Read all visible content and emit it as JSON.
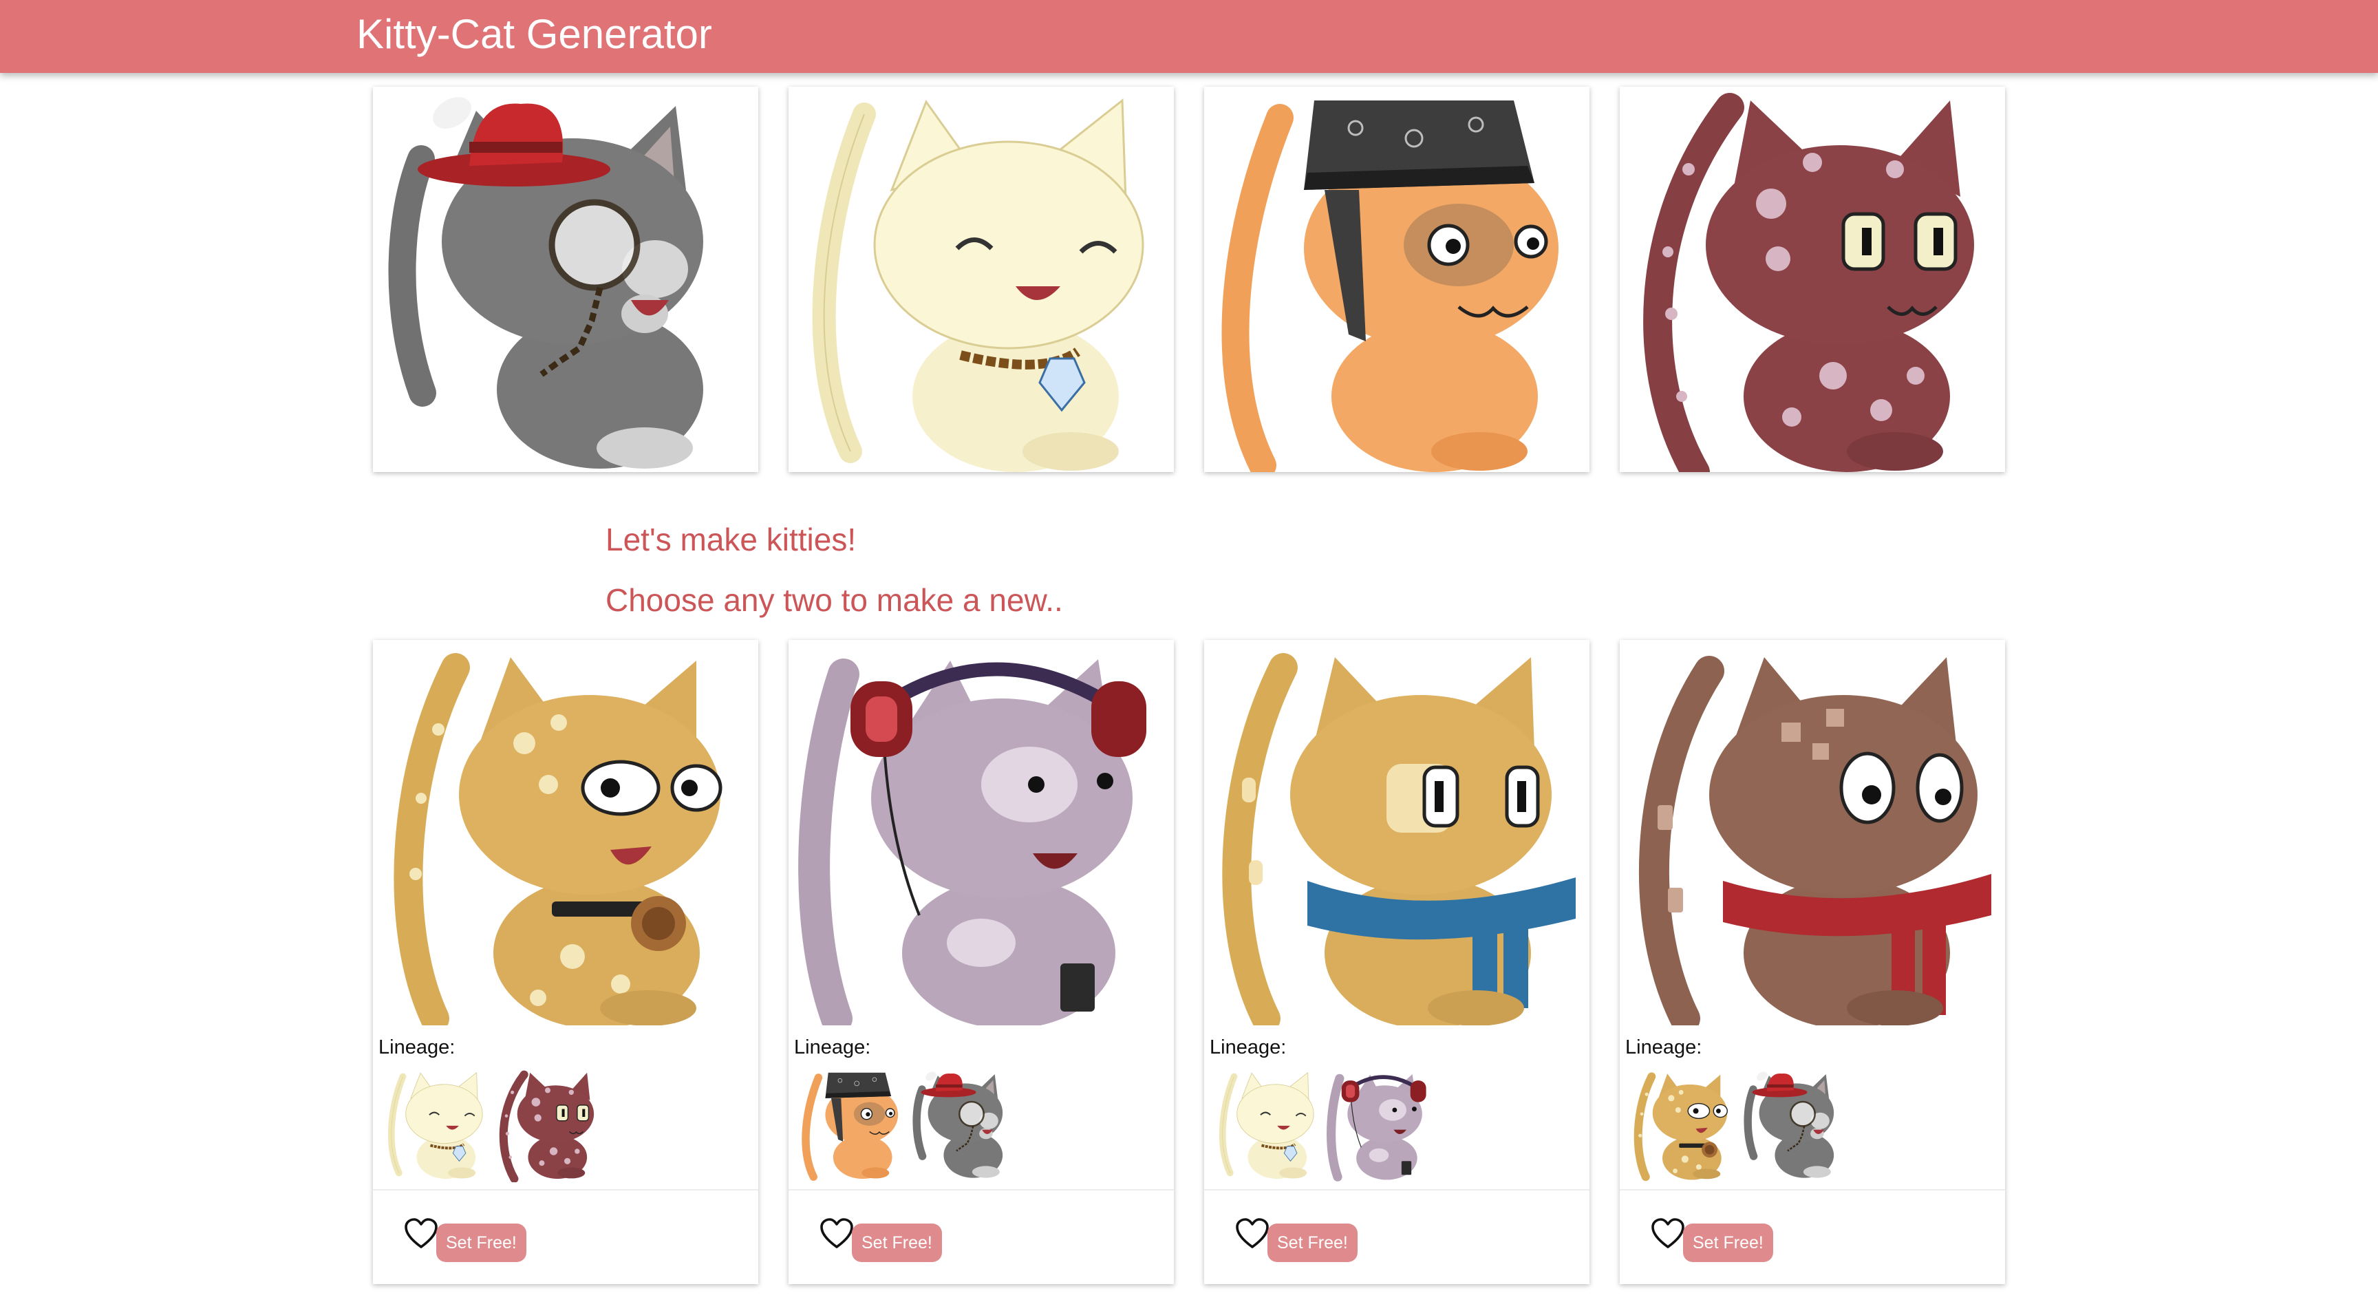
{
  "app": {
    "title": "Kitty-Cat Generator"
  },
  "colors": {
    "navbar": "#e07375",
    "accent_text": "#cc5558",
    "button": "#df8a8d"
  },
  "intro": {
    "line1": "Let's make kitties!",
    "line2": "Choose any two to make a new.."
  },
  "parents": [
    {
      "name": "gray-cat-with-top-hat-and-monocle"
    },
    {
      "name": "cream-cat-with-diamond-collar"
    },
    {
      "name": "orange-cat-with-paisley-bandana"
    },
    {
      "name": "maroon-spotted-cat"
    }
  ],
  "offspring": [
    {
      "name": "golden-spotted-cat-with-sock-monkey-collar",
      "lineage_label": "Lineage:",
      "lineage": [
        "cream-cat-with-diamond-collar",
        "maroon-spotted-cat"
      ],
      "free_label": "Set Free!",
      "like_icon": "heart-outline-icon"
    },
    {
      "name": "lavender-cat-with-headphones",
      "lineage_label": "Lineage:",
      "lineage": [
        "orange-cat-with-paisley-bandana",
        "gray-cat-with-top-hat-and-monocle"
      ],
      "free_label": "Set Free!",
      "like_icon": "heart-outline-icon"
    },
    {
      "name": "golden-cat-with-blue-scarf",
      "lineage_label": "Lineage:",
      "lineage": [
        "cream-cat-with-diamond-collar",
        "lavender-cat-with-headphones"
      ],
      "free_label": "Set Free!",
      "like_icon": "heart-outline-icon"
    },
    {
      "name": "brown-cat-with-red-scarf",
      "lineage_label": "Lineage:",
      "lineage": [
        "golden-spotted-cat-with-sock-monkey-collar",
        "gray-cat-with-top-hat-and-monocle"
      ],
      "free_label": "Set Free!",
      "like_icon": "heart-outline-icon"
    }
  ]
}
